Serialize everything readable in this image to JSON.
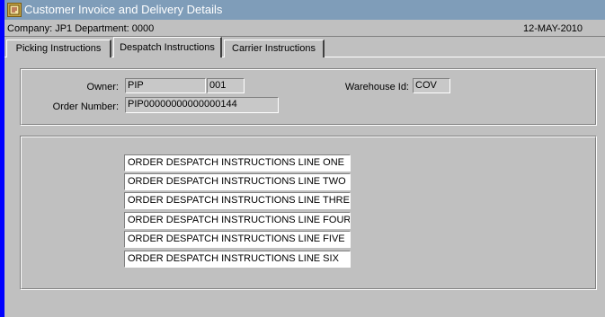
{
  "window": {
    "title": "Customer Invoice and Delivery Details"
  },
  "info": {
    "company_dept": "Company:  JP1   Department:  0000",
    "date": "12-MAY-2010"
  },
  "tabs": [
    {
      "label": "Picking Instructions",
      "active": false
    },
    {
      "label": "Despatch Instructions",
      "active": true
    },
    {
      "label": "Carrier Instructions",
      "active": false
    }
  ],
  "header": {
    "owner_label": "Owner:",
    "owner_value": "PIP",
    "owner_code": "001",
    "order_number_label": "Order Number:",
    "order_number_value": "PIP00000000000000144",
    "warehouse_label": "Warehouse Id:",
    "warehouse_value": "COV"
  },
  "instructions": [
    "ORDER DESPATCH INSTRUCTIONS LINE ONE",
    "ORDER DESPATCH INSTRUCTIONS LINE TWO",
    "ORDER DESPATCH INSTRUCTIONS LINE  THREE",
    "ORDER DESPATCH INSTRUCTIONS LINE FOUR",
    "ORDER DESPATCH INSTRUCTIONS LINE FIVE",
    "ORDER DESPATCH INSTRUCTIONS LINE SIX"
  ],
  "colors": {
    "titlebar": "#7f9db9",
    "window_edge": "#0000ff",
    "background": "#c0c0c0"
  },
  "icons": {
    "app": "app-window-icon"
  }
}
